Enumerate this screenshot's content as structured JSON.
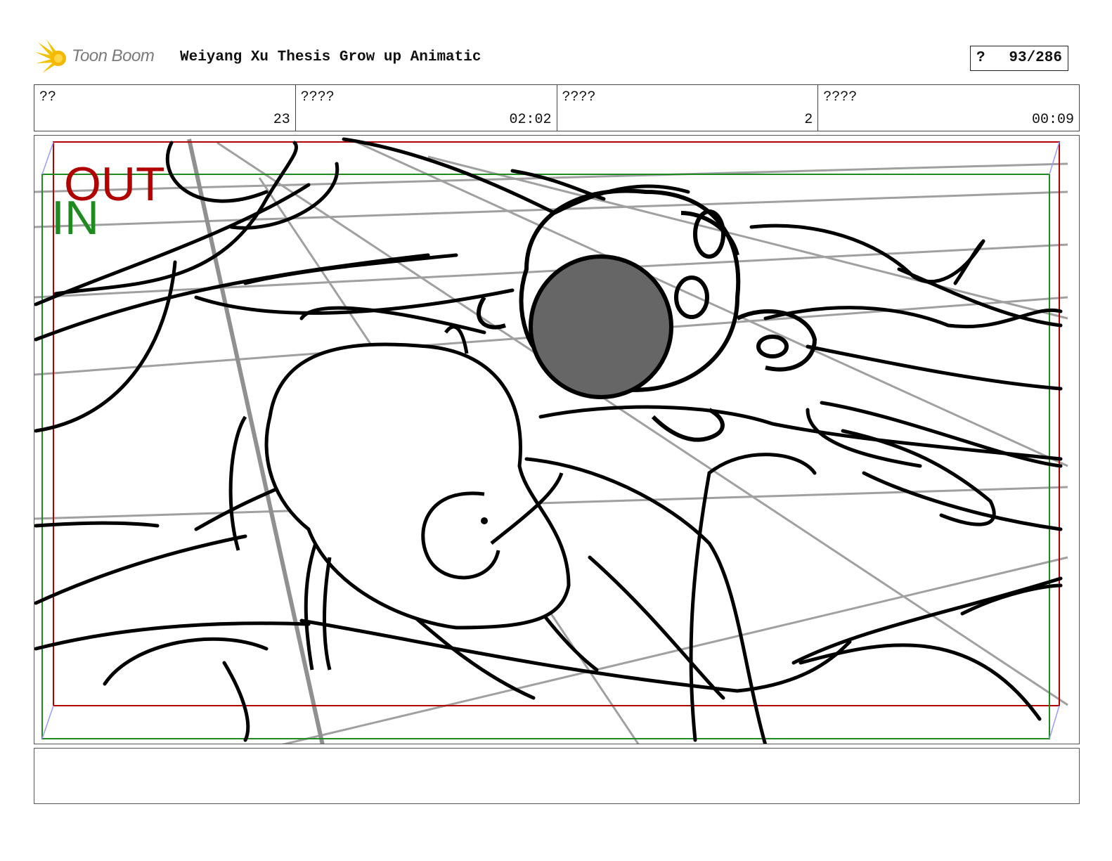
{
  "header": {
    "logo_text": "Toon Boom",
    "title": "Weiyang Xu Thesis Grow up Animatic",
    "page_marker": "?",
    "page_count": "93/286"
  },
  "info": [
    {
      "label": "??",
      "value": "23"
    },
    {
      "label": "????",
      "value": "02:02"
    },
    {
      "label": "????",
      "value": "2"
    },
    {
      "label": "????",
      "value": "00:09"
    }
  ],
  "panel": {
    "out_label": "OUT",
    "in_label": "IN",
    "colors": {
      "out": "#b00000",
      "in": "#1f8a1f",
      "sketch": "#000000",
      "guide": "#9a9a9a",
      "fill": "#666666"
    }
  },
  "notes": {
    "text": ""
  }
}
